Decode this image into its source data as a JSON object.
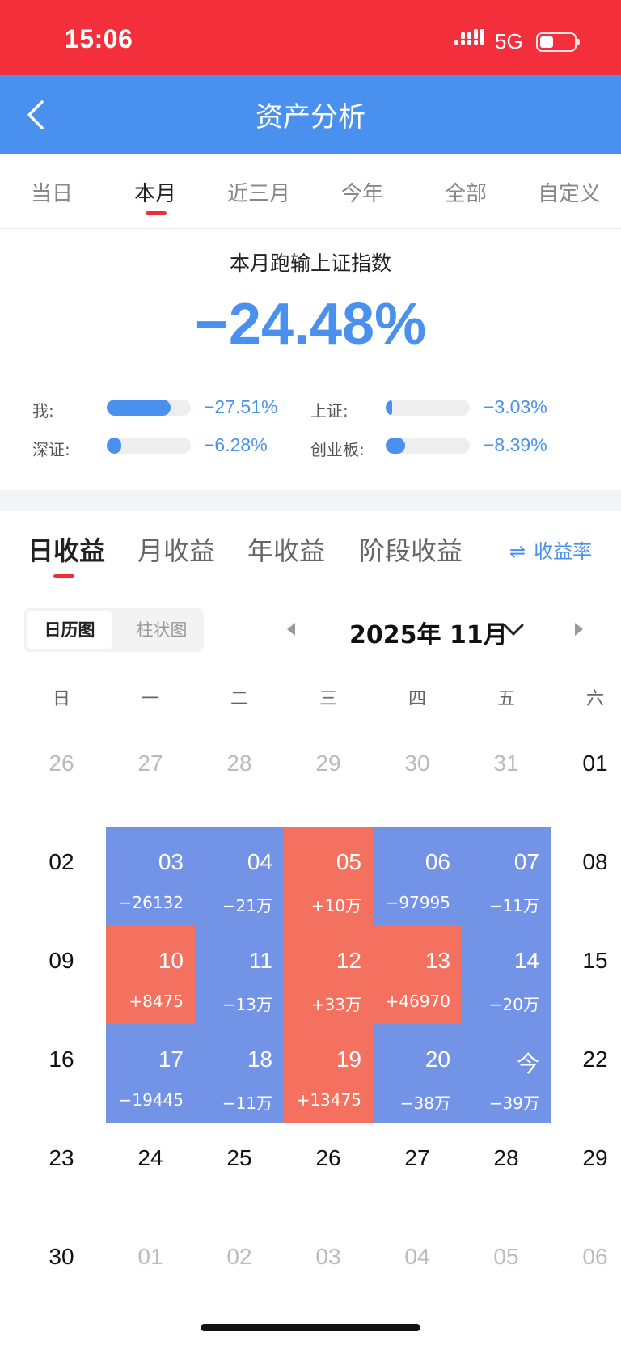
{
  "status_bar": {
    "time": "15:06",
    "network": "5G"
  },
  "header": {
    "title": "资产分析"
  },
  "period_tabs": [
    {
      "label": "当日",
      "active": false
    },
    {
      "label": "本月",
      "active": true
    },
    {
      "label": "近三月",
      "active": false
    },
    {
      "label": "今年",
      "active": false
    },
    {
      "label": "全部",
      "active": false
    },
    {
      "label": "自定义",
      "active": false
    }
  ],
  "summary": {
    "title": "本月跑输上证指数",
    "value": "−24.48%"
  },
  "comparisons": [
    {
      "label": "我:",
      "value": "−27.51%",
      "fill_percent": 76
    },
    {
      "label": "上证:",
      "value": "−3.03%",
      "fill_percent": 8
    },
    {
      "label": "深证:",
      "value": "−6.28%",
      "fill_percent": 17
    },
    {
      "label": "创业板:",
      "value": "−8.39%",
      "fill_percent": 23
    }
  ],
  "colors": {
    "accent": "#4a90ef",
    "loss": "#7393e6",
    "gain": "#f4715f",
    "indicator": "#ef2c3a",
    "status_bar": "#f22f3a"
  },
  "earnings_tabs": [
    {
      "label": "日收益",
      "active": true
    },
    {
      "label": "月收益",
      "active": false
    },
    {
      "label": "年收益",
      "active": false
    },
    {
      "label": "阶段收益",
      "active": false
    }
  ],
  "rate_toggle": {
    "icon": "swap-icon",
    "label": "收益率"
  },
  "view_toggle": {
    "calendar_label": "日历图",
    "bar_label": "柱状图",
    "active": "日历图"
  },
  "month_selector": {
    "label": "2025年 11月"
  },
  "weekdays": [
    "日",
    "一",
    "二",
    "三",
    "四",
    "五",
    "六"
  ],
  "calendar": [
    [
      {
        "day": "26",
        "state": "dim"
      },
      {
        "day": "27",
        "state": "dim"
      },
      {
        "day": "28",
        "state": "dim"
      },
      {
        "day": "29",
        "state": "dim"
      },
      {
        "day": "30",
        "state": "dim"
      },
      {
        "day": "31",
        "state": "dim"
      },
      {
        "day": "01",
        "state": "plain"
      }
    ],
    [
      {
        "day": "02",
        "state": "plain"
      },
      {
        "day": "03",
        "state": "loss",
        "amount": "−26132"
      },
      {
        "day": "04",
        "state": "loss",
        "amount": "−21万"
      },
      {
        "day": "05",
        "state": "gain",
        "amount": "+10万"
      },
      {
        "day": "06",
        "state": "loss",
        "amount": "−97995"
      },
      {
        "day": "07",
        "state": "loss",
        "amount": "−11万"
      },
      {
        "day": "08",
        "state": "plain"
      }
    ],
    [
      {
        "day": "09",
        "state": "plain"
      },
      {
        "day": "10",
        "state": "gain",
        "amount": "+8475"
      },
      {
        "day": "11",
        "state": "loss",
        "amount": "−13万"
      },
      {
        "day": "12",
        "state": "gain",
        "amount": "+33万"
      },
      {
        "day": "13",
        "state": "gain",
        "amount": "+46970"
      },
      {
        "day": "14",
        "state": "loss",
        "amount": "−20万"
      },
      {
        "day": "15",
        "state": "plain"
      }
    ],
    [
      {
        "day": "16",
        "state": "plain"
      },
      {
        "day": "17",
        "state": "loss",
        "amount": "−19445"
      },
      {
        "day": "18",
        "state": "loss",
        "amount": "−11万"
      },
      {
        "day": "19",
        "state": "gain",
        "amount": "+13475"
      },
      {
        "day": "20",
        "state": "loss",
        "amount": "−38万"
      },
      {
        "day": "今",
        "state": "loss",
        "amount": "−39万"
      },
      {
        "day": "22",
        "state": "plain"
      }
    ],
    [
      {
        "day": "23",
        "state": "plain"
      },
      {
        "day": "24",
        "state": "plain"
      },
      {
        "day": "25",
        "state": "plain"
      },
      {
        "day": "26",
        "state": "plain"
      },
      {
        "day": "27",
        "state": "plain"
      },
      {
        "day": "28",
        "state": "plain"
      },
      {
        "day": "29",
        "state": "plain"
      }
    ],
    [
      {
        "day": "30",
        "state": "plain"
      },
      {
        "day": "01",
        "state": "dim"
      },
      {
        "day": "02",
        "state": "dim"
      },
      {
        "day": "03",
        "state": "dim"
      },
      {
        "day": "04",
        "state": "dim"
      },
      {
        "day": "05",
        "state": "dim"
      },
      {
        "day": "06",
        "state": "dim"
      }
    ]
  ]
}
